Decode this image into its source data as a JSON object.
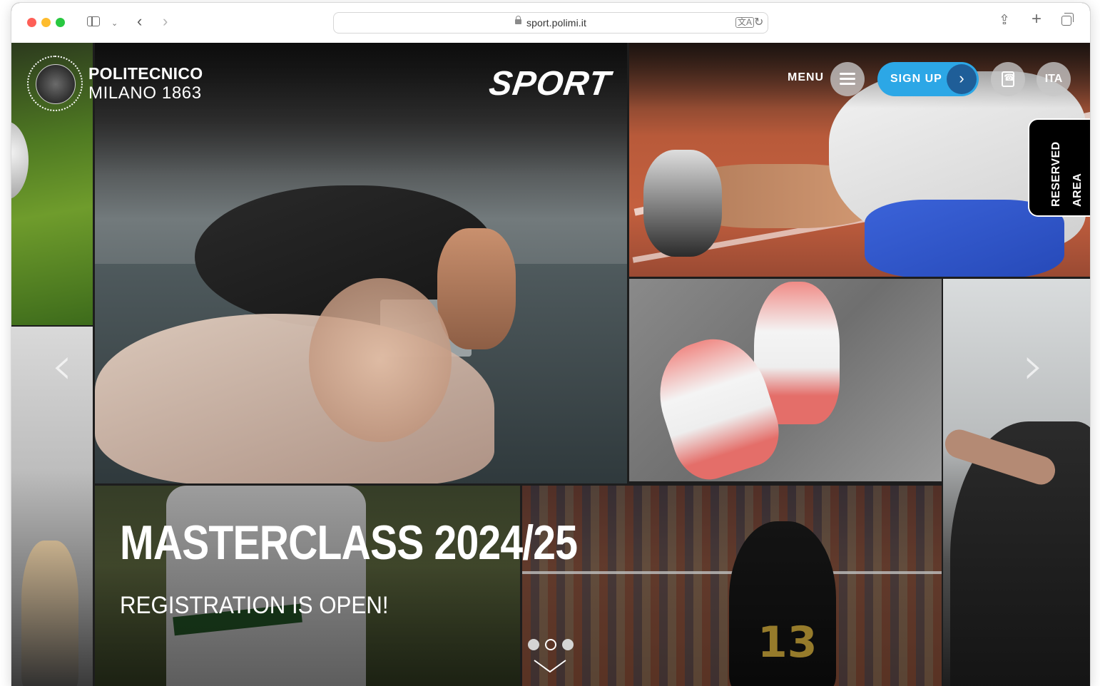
{
  "browser": {
    "url": "sport.polimi.it",
    "icons": [
      "sidebar-icon",
      "chevron-down-icon",
      "back-icon",
      "forward-icon",
      "lock-icon",
      "translate-icon",
      "reload-icon",
      "share-icon",
      "new-tab-icon",
      "tab-overview-icon"
    ],
    "back_glyph": "‹",
    "forward_glyph": "›",
    "reload_glyph": "↻",
    "translate_glyph": "文A",
    "share_glyph": "⇪",
    "plus_glyph": "+"
  },
  "header": {
    "logo_line1": "POLITECNICO",
    "logo_line2": "MILANO 1863",
    "site_logo": "SPORT",
    "menu_label": "MENU",
    "signup_label": "SIGN UP",
    "signup_arrow": "›",
    "language_label": "ITA",
    "reserved_area_label": "RESERVED AREA"
  },
  "slider": {
    "title": "MASTERCLASS 2024/25",
    "subtitle": "REGISTRATION IS OPEN!",
    "prev_glyph": "‹",
    "next_glyph": "›",
    "dots": [
      "filled",
      "empty",
      "filled"
    ],
    "active_dot_index": 1
  },
  "colors": {
    "accent": "#2ca7e6",
    "signup_arrow_bg": "#1f5e98",
    "hero_bg": "#000000"
  }
}
